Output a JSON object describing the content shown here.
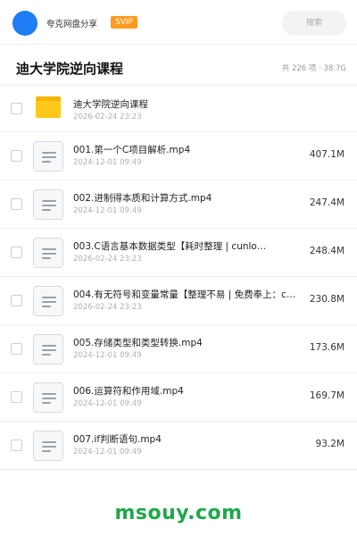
{
  "topbar": {
    "share_name": "夸克网盘分享",
    "badge": "SVIP",
    "search_placeholder": "搜索"
  },
  "header": {
    "title": "迪大学院逆向课程",
    "summary": "共 226 项 · 38.7G"
  },
  "files": [
    {
      "name": "迪大学院逆向课程",
      "date": "2026-02-24 23:23",
      "size": "",
      "type": "folder"
    },
    {
      "name": "001.第一个C项目解析.mp4",
      "date": "2024-12-01 09:49",
      "size": "407.1M",
      "type": "file"
    },
    {
      "name": "002.进制得本质和计算方式.mp4",
      "date": "2024-12-01 09:49",
      "size": "247.4M",
      "type": "file"
    },
    {
      "name": "003.C语言基本数据类型【耗时整理 | cunlo…",
      "date": "2026-02-24 23:23",
      "size": "248.4M",
      "type": "file"
    },
    {
      "name": "004.有无符号和变量常量【整理不易 | 免费奉上：c…",
      "date": "2026-02-24 23:23",
      "size": "230.8M",
      "type": "file"
    },
    {
      "name": "005.存储类型和类型转换.mp4",
      "date": "2024-12-01 09:49",
      "size": "173.6M",
      "type": "file"
    },
    {
      "name": "006.运算符和作用域.mp4",
      "date": "2024-12-01 09:49",
      "size": "169.7M",
      "type": "file"
    },
    {
      "name": "007.if判断语句.mp4",
      "date": "2024-12-01 09:49",
      "size": "93.2M",
      "type": "file"
    }
  ],
  "watermark": "msouy.com",
  "colors": {
    "avatar": "#1f7cf5",
    "svip": "#ff9a1f",
    "folder": "#ffc81a",
    "watermark": "#1fa84a"
  }
}
